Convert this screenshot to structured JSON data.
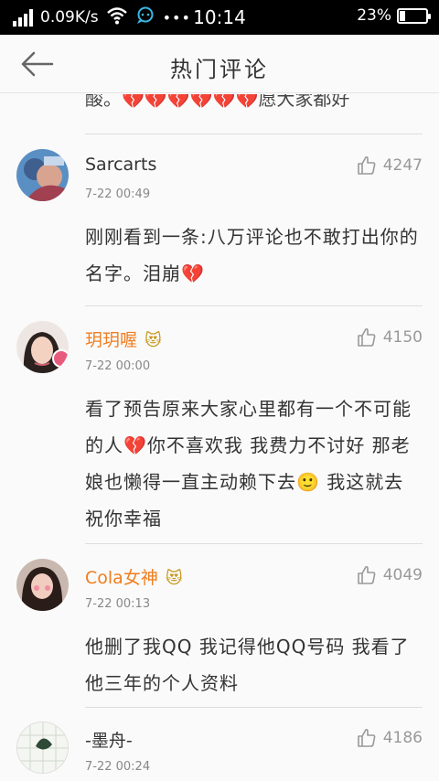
{
  "status_bar": {
    "speed": "0.09K/s",
    "dots": "•••",
    "time": "10:14",
    "battery_pct": "23%",
    "battery_level": 0.23
  },
  "header": {
    "back_icon": "arrow-left-icon",
    "title": "热门评论"
  },
  "prev_tail": "酸。💔💔💔💔💔💔愿大家都好",
  "comments": [
    {
      "name": "Sarcarts",
      "time": "7-22 00:49",
      "likes": "4247",
      "body": "刚刚看到一条:八万评论也不敢打出你的名字。泪崩💔"
    },
    {
      "name": "玥玥喔",
      "name_emoji": "😻",
      "time": "7-22 00:00",
      "likes": "4150",
      "body": "看了预告原来大家心里都有一个不可能的人💔你不喜欢我  我费力不讨好  那老娘也懒得一直主动赖下去🙂  我这就去祝你幸福"
    },
    {
      "name": "Cola女神",
      "name_emoji": "😻",
      "time": "7-22 00:13",
      "likes": "4049",
      "body": "他删了我QQ 我记得他QQ号码 我看了他三年的个人资料"
    },
    {
      "name": "-墨舟-",
      "time": "7-22 00:24",
      "likes": "4186"
    }
  ],
  "colors": {
    "name_highlight": "#f07d1e",
    "heart": "#d41f2e",
    "like_icon": "#999999"
  }
}
